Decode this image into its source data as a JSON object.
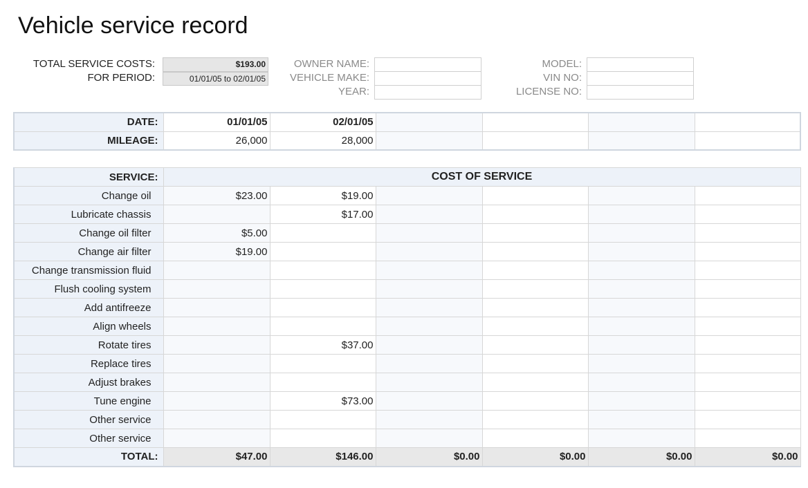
{
  "title": "Vehicle service record",
  "summary": {
    "total_label": "TOTAL SERVICE COSTS:",
    "total_value": "$193.00",
    "period_label": "FOR PERIOD:",
    "period_value": "01/01/05 to 02/01/05",
    "owner_label": "OWNER NAME:",
    "make_label": "VEHICLE MAKE:",
    "year_label": "YEAR:",
    "model_label": "MODEL:",
    "vin_label": "VIN NO:",
    "license_label": "LICENSE NO:",
    "owner_value": "",
    "make_value": "",
    "year_value": "",
    "model_value": "",
    "vin_value": "",
    "license_value": ""
  },
  "header_table": {
    "date_label": "DATE:",
    "mileage_label": "MILEAGE:",
    "dates": [
      "01/01/05",
      "02/01/05",
      "",
      "",
      "",
      ""
    ],
    "mileage": [
      "26,000",
      "28,000",
      "",
      "",
      "",
      ""
    ]
  },
  "service_table": {
    "service_label": "SERVICE:",
    "cost_label": "COST OF SERVICE",
    "rows": [
      {
        "name": "Change oil",
        "costs": [
          "$23.00",
          "$19.00",
          "",
          "",
          "",
          ""
        ]
      },
      {
        "name": "Lubricate chassis",
        "costs": [
          "",
          "$17.00",
          "",
          "",
          "",
          ""
        ]
      },
      {
        "name": "Change oil filter",
        "costs": [
          "$5.00",
          "",
          "",
          "",
          "",
          ""
        ]
      },
      {
        "name": "Change air filter",
        "costs": [
          "$19.00",
          "",
          "",
          "",
          "",
          ""
        ]
      },
      {
        "name": "Change transmission fluid",
        "costs": [
          "",
          "",
          "",
          "",
          "",
          ""
        ]
      },
      {
        "name": "Flush cooling system",
        "costs": [
          "",
          "",
          "",
          "",
          "",
          ""
        ]
      },
      {
        "name": "Add antifreeze",
        "costs": [
          "",
          "",
          "",
          "",
          "",
          ""
        ]
      },
      {
        "name": "Align wheels",
        "costs": [
          "",
          "",
          "",
          "",
          "",
          ""
        ]
      },
      {
        "name": "Rotate tires",
        "costs": [
          "",
          "$37.00",
          "",
          "",
          "",
          ""
        ]
      },
      {
        "name": "Replace tires",
        "costs": [
          "",
          "",
          "",
          "",
          "",
          ""
        ]
      },
      {
        "name": "Adjust brakes",
        "costs": [
          "",
          "",
          "",
          "",
          "",
          ""
        ]
      },
      {
        "name": "Tune engine",
        "costs": [
          "",
          "$73.00",
          "",
          "",
          "",
          ""
        ]
      },
      {
        "name": "Other service",
        "costs": [
          "",
          "",
          "",
          "",
          "",
          ""
        ]
      },
      {
        "name": "Other service",
        "costs": [
          "",
          "",
          "",
          "",
          "",
          ""
        ]
      }
    ],
    "total_label": "TOTAL:",
    "totals": [
      "$47.00",
      "$146.00",
      "$0.00",
      "$0.00",
      "$0.00",
      "$0.00"
    ]
  }
}
